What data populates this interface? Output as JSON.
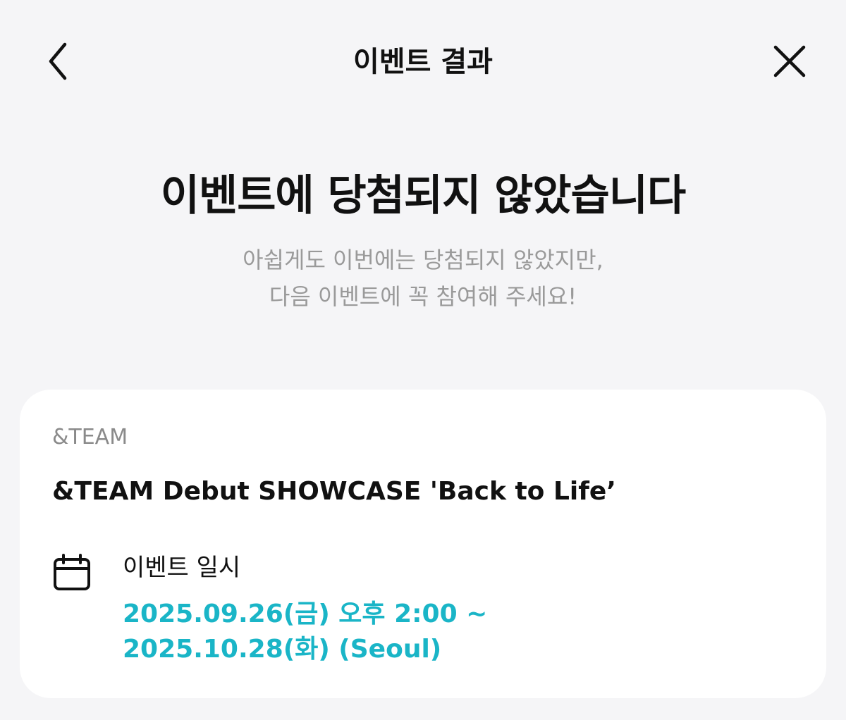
{
  "header": {
    "title": "이벤트 결과",
    "back_icon": "chevron-left-icon",
    "close_icon": "close-icon"
  },
  "result": {
    "headline": "이벤트에 당첨되지 않았습니다",
    "sub_line1": "아쉽게도 이번에는 당첨되지 않았지만,",
    "sub_line2": "다음 이벤트에 꼭 참여해 주세요!"
  },
  "event_card": {
    "artist": "&TEAM",
    "title": "&TEAM Debut SHOWCASE 'Back to Life’",
    "date_icon": "calendar-icon",
    "date_label": "이벤트 일시",
    "date_start": "2025.09.26(금) 오후 2:00 ~",
    "date_end": "2025.10.28(화) (Seoul)"
  },
  "colors": {
    "background": "#f5f5f7",
    "card": "#ffffff",
    "accent": "#1ab5c7",
    "subtext": "#9a9a9a"
  }
}
